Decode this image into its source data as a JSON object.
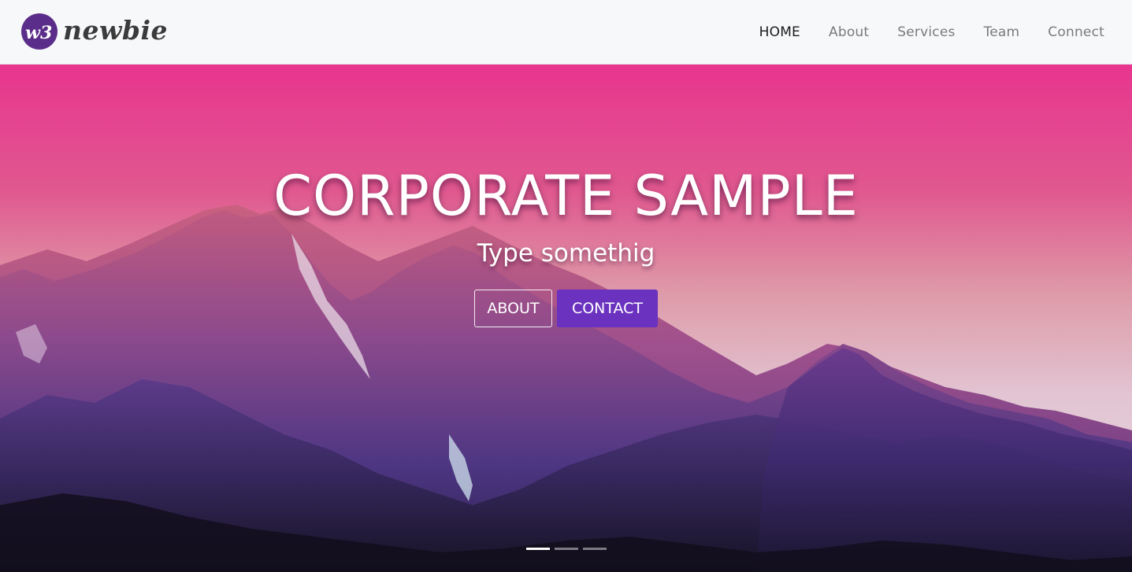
{
  "navbar": {
    "brand": {
      "logo_mark": "w3",
      "logo_text": "newbie"
    },
    "links": [
      {
        "label": "HOME",
        "active": true
      },
      {
        "label": "About",
        "active": false
      },
      {
        "label": "Services",
        "active": false
      },
      {
        "label": "Team",
        "active": false
      },
      {
        "label": "Connect",
        "active": false
      }
    ]
  },
  "hero": {
    "title": "CORPORATE SAMPLE",
    "subtitle": "Type somethig",
    "buttons": {
      "about_label": "ABOUT",
      "contact_label": "CONTACT"
    },
    "carousel": {
      "slide_count": 3,
      "active_index": 0
    }
  },
  "colors": {
    "brand_purple": "#5b2d8a",
    "contact_button": "#6b32c0",
    "navbar_bg": "#f7f8fa",
    "sky_top": "#e8358f",
    "sky_horizon": "#e6c9d8"
  }
}
